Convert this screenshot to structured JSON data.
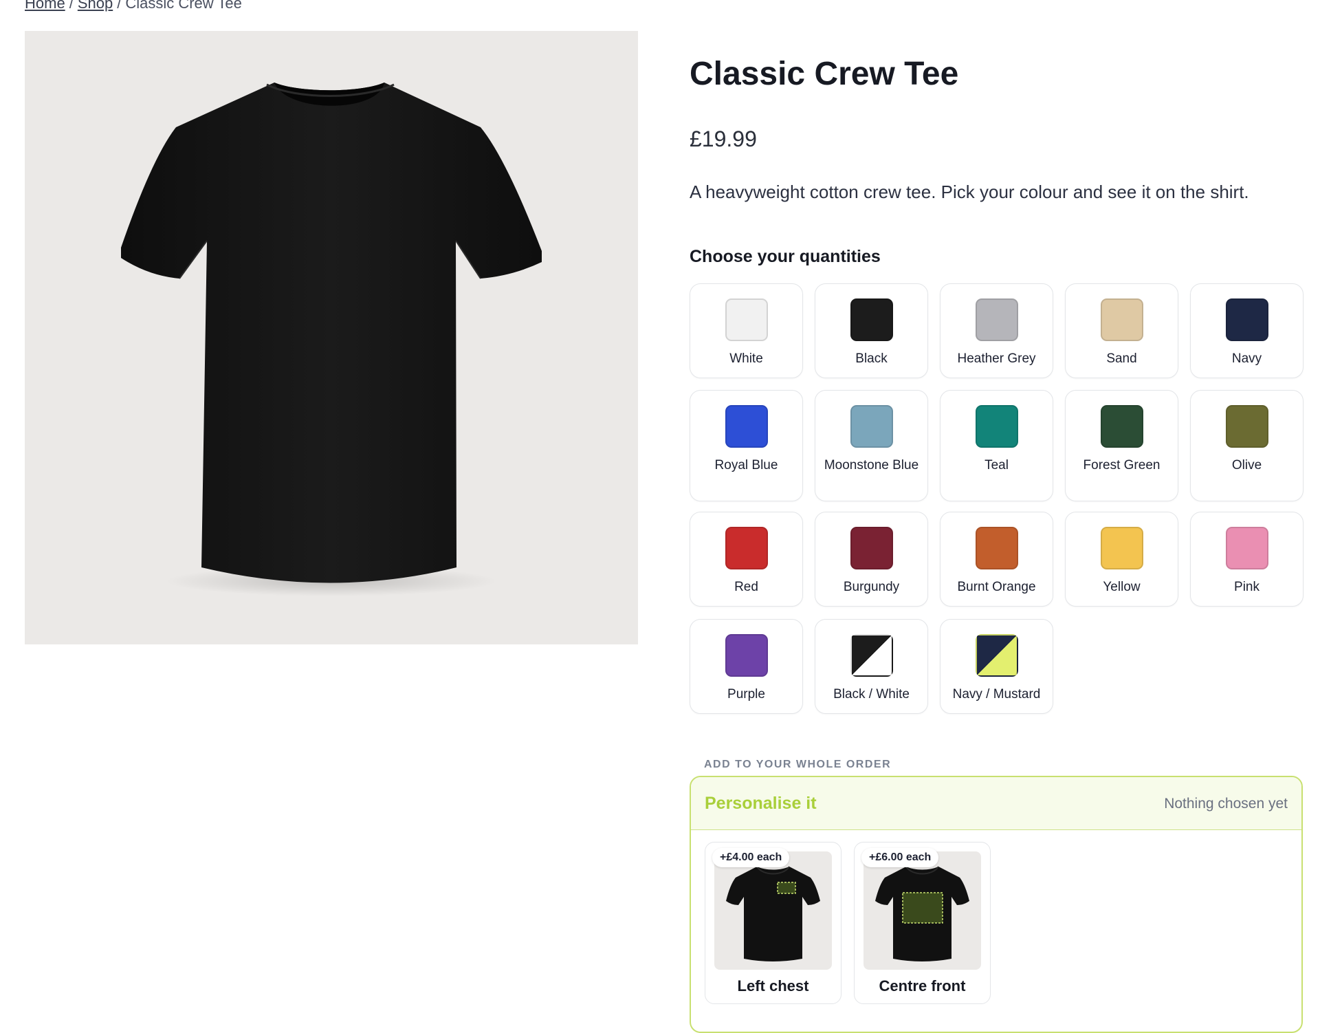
{
  "breadcrumb": {
    "home": "Home",
    "shop": "Shop",
    "current": "Classic Crew Tee"
  },
  "product": {
    "title": "Classic Crew Tee",
    "price": "£19.99",
    "description": "A heavyweight cotton crew tee. Pick your colour and see it on the shirt.",
    "image_alt": "Black t-shirt"
  },
  "quantities": {
    "heading": "Choose your quantities",
    "colours": [
      {
        "name": "White",
        "color": "#f1f1f1"
      },
      {
        "name": "Black",
        "color": "#1c1c1c"
      },
      {
        "name": "Heather Grey",
        "color": "#b5b5ba"
      },
      {
        "name": "Sand",
        "color": "#dfc9a4"
      },
      {
        "name": "Navy",
        "color": "#1e2845"
      },
      {
        "name": "Royal Blue",
        "color": "#2d4fd6"
      },
      {
        "name": "Moonstone Blue",
        "color": "#7ba6bb"
      },
      {
        "name": "Teal",
        "color": "#128479"
      },
      {
        "name": "Forest Green",
        "color": "#2b4d35"
      },
      {
        "name": "Olive",
        "color": "#6b6b32"
      },
      {
        "name": "Red",
        "color": "#c92c2c"
      },
      {
        "name": "Burgundy",
        "color": "#7a2233"
      },
      {
        "name": "Burnt Orange",
        "color": "#c25e2c"
      },
      {
        "name": "Yellow",
        "color": "#f3c450"
      },
      {
        "name": "Pink",
        "color": "#ea8fb2"
      },
      {
        "name": "Purple",
        "color": "#6d42a8"
      },
      {
        "name": "Black / White",
        "color": "#1c1c1c",
        "color2": "#ffffff"
      },
      {
        "name": "Navy / Mustard",
        "color": "#1e2845",
        "color2": "#e3ef6f"
      }
    ]
  },
  "personalise": {
    "section_label": "ADD TO YOUR WHOLE ORDER",
    "title": "Personalise it",
    "status": "Nothing chosen yet",
    "options": [
      {
        "label": "Left chest",
        "price": "+£4.00 each",
        "placement": "left-chest"
      },
      {
        "label": "Centre front",
        "price": "+£6.00 each",
        "placement": "centre-front"
      }
    ]
  }
}
